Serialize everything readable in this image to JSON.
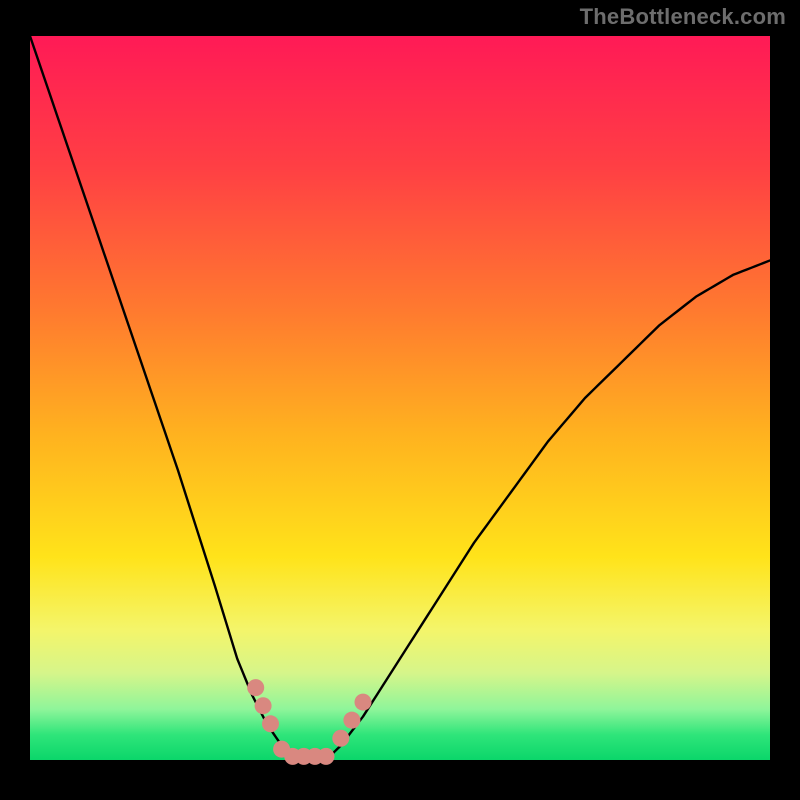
{
  "watermark": "TheBottleneck.com",
  "chart_data": {
    "type": "line",
    "title": "",
    "xlabel": "",
    "ylabel": "",
    "xlim": [
      0,
      100
    ],
    "ylim": [
      0,
      100
    ],
    "grid": false,
    "legend": false,
    "series": [
      {
        "name": "left-curve",
        "x": [
          0,
          5,
          10,
          15,
          20,
          25,
          28,
          30,
          32,
          34,
          35
        ],
        "values": [
          100,
          85,
          70,
          55,
          40,
          24,
          14,
          9,
          5,
          2,
          0
        ]
      },
      {
        "name": "right-curve",
        "x": [
          40,
          42,
          45,
          50,
          55,
          60,
          65,
          70,
          75,
          80,
          85,
          90,
          95,
          100
        ],
        "values": [
          0,
          2,
          6,
          14,
          22,
          30,
          37,
          44,
          50,
          55,
          60,
          64,
          67,
          69
        ]
      },
      {
        "name": "valley-flat",
        "x": [
          35,
          40
        ],
        "values": [
          0,
          0
        ]
      }
    ],
    "highlight_points": {
      "name": "salmon-dots",
      "color": "#d98880",
      "points": [
        {
          "x": 30.5,
          "y": 10
        },
        {
          "x": 31.5,
          "y": 7.5
        },
        {
          "x": 32.5,
          "y": 5
        },
        {
          "x": 34,
          "y": 1.5
        },
        {
          "x": 35.5,
          "y": 0.5
        },
        {
          "x": 37,
          "y": 0.5
        },
        {
          "x": 38.5,
          "y": 0.5
        },
        {
          "x": 40,
          "y": 0.5
        },
        {
          "x": 42,
          "y": 3
        },
        {
          "x": 43.5,
          "y": 5.5
        },
        {
          "x": 45,
          "y": 8
        }
      ]
    },
    "background_gradient": {
      "stops": [
        {
          "offset": 0.0,
          "color": "#ff1a56"
        },
        {
          "offset": 0.18,
          "color": "#ff3f44"
        },
        {
          "offset": 0.38,
          "color": "#ff7a2f"
        },
        {
          "offset": 0.55,
          "color": "#ffb21f"
        },
        {
          "offset": 0.72,
          "color": "#ffe31a"
        },
        {
          "offset": 0.82,
          "color": "#f4f56a"
        },
        {
          "offset": 0.88,
          "color": "#d6f58a"
        },
        {
          "offset": 0.93,
          "color": "#8ef59a"
        },
        {
          "offset": 0.965,
          "color": "#2fe57a"
        },
        {
          "offset": 1.0,
          "color": "#0bd66a"
        }
      ]
    },
    "frame_color": "#000000",
    "frame_thickness_top": 36,
    "frame_thickness_sides": 30,
    "frame_thickness_bottom": 40
  }
}
